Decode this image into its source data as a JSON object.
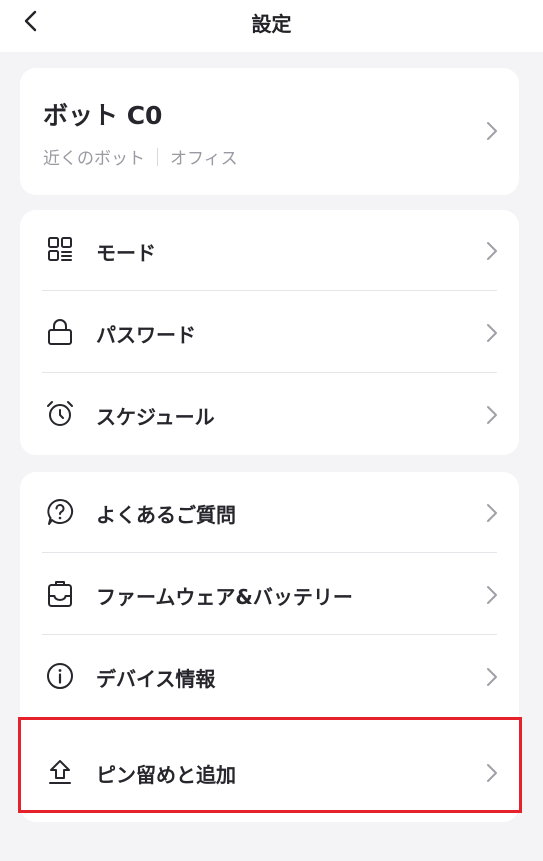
{
  "header": {
    "title": "設定",
    "back_icon": "chevron-left-icon"
  },
  "device": {
    "name": "ボット C0",
    "location": "近くのボット",
    "room": "オフィス"
  },
  "group1": [
    {
      "label": "モード",
      "icon": "mode-grid-icon"
    },
    {
      "label": "パスワード",
      "icon": "lock-icon"
    },
    {
      "label": "スケジュール",
      "icon": "alarm-clock-icon"
    }
  ],
  "group2": [
    {
      "label": "よくあるご質問",
      "icon": "question-icon"
    },
    {
      "label": "ファームウェア&バッテリー",
      "icon": "firmware-icon"
    },
    {
      "label": "デバイス情報",
      "icon": "info-icon"
    },
    {
      "label": "ピン留めと追加",
      "icon": "pin-upload-icon"
    }
  ],
  "colors": {
    "background": "#f4f4f6",
    "card": "#ffffff",
    "text": "#26262c",
    "secondary_text": "#9a9aa2",
    "chevron": "#a0a0a8",
    "highlight": "#e5222b"
  }
}
